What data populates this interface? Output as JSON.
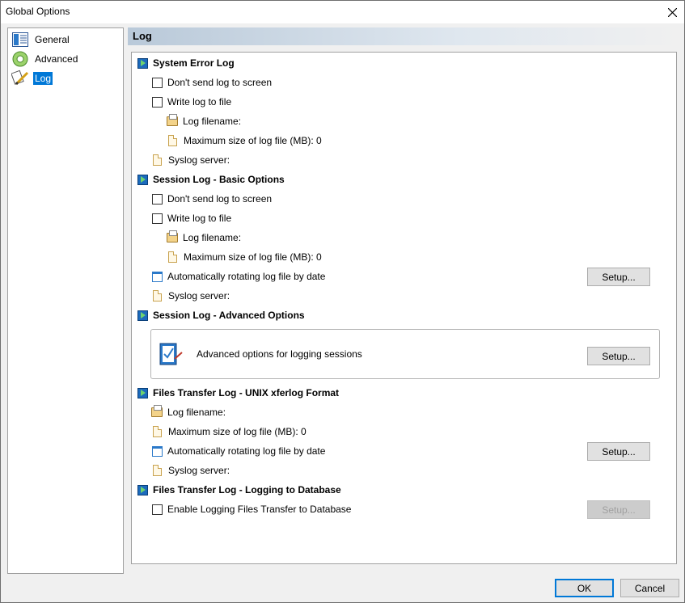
{
  "window": {
    "title": "Global Options"
  },
  "nav": {
    "items": [
      {
        "label": "General",
        "icon": "general-icon",
        "selected": false
      },
      {
        "label": "Advanced",
        "icon": "gear-icon",
        "selected": false
      },
      {
        "label": "Log",
        "icon": "log-pen-icon",
        "selected": true
      }
    ]
  },
  "page": {
    "heading": "Log"
  },
  "system_error": {
    "title": "System Error Log",
    "dont_send": "Don't send log to screen",
    "write_file": "Write log to file",
    "filename": "Log filename:",
    "max_size": "Maximum size of log file (MB): 0",
    "syslog": "Syslog server:"
  },
  "session_basic": {
    "title": "Session Log - Basic Options",
    "dont_send": "Don't send log to screen",
    "write_file": "Write log to file",
    "filename": "Log filename:",
    "max_size": "Maximum size of log file (MB): 0",
    "rotating": "Automatically rotating log file by date",
    "setup": "Setup...",
    "syslog": "Syslog server:"
  },
  "session_advanced": {
    "title": "Session Log - Advanced Options",
    "description": "Advanced options for logging sessions",
    "setup": "Setup..."
  },
  "files_unix": {
    "title": "Files Transfer Log - UNIX xferlog Format",
    "filename": "Log filename:",
    "max_size": "Maximum size of log file (MB): 0",
    "rotating": "Automatically rotating log file by date",
    "setup": "Setup...",
    "syslog": "Syslog server:"
  },
  "files_db": {
    "title": "Files Transfer Log - Logging to Database",
    "enable": "Enable Logging Files Transfer to Database",
    "setup": "Setup..."
  },
  "footer": {
    "ok": "OK",
    "cancel": "Cancel"
  },
  "colors": {
    "accent": "#0078d7",
    "section_icon": "#1c6bbd"
  }
}
